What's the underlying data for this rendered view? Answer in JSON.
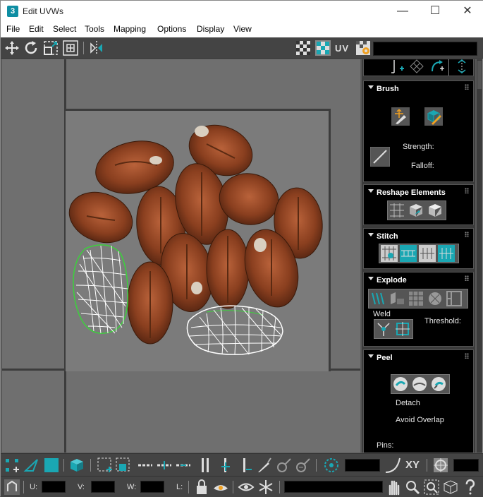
{
  "window": {
    "app_icon": "3",
    "title": "Edit UVWs"
  },
  "menu": [
    "File",
    "Edit",
    "Select",
    "Tools",
    "Mapping",
    "Options",
    "Display",
    "View"
  ],
  "toolbar_top": {
    "uv_label": "UV",
    "icons": [
      "move-icon",
      "rotate-icon",
      "scale-icon",
      "freeform-icon",
      "mirror-icon",
      "checker-icon",
      "texture-checker-icon",
      "settings-icon"
    ]
  },
  "panel": {
    "brush": {
      "title": "Brush",
      "strength_label": "Strength:",
      "falloff_label": "Falloff:"
    },
    "reshape": {
      "title": "Reshape Elements"
    },
    "stitch": {
      "title": "Stitch"
    },
    "explode": {
      "title": "Explode",
      "weld_label": "Weld",
      "threshold_label": "Threshold:"
    },
    "peel": {
      "title": "Peel",
      "detach_label": "Detach",
      "avoid_overlap_label": "Avoid Overlap",
      "pins_label": "Pins:"
    }
  },
  "bottom": {
    "xy_label": "XY",
    "u_label": "U:",
    "v_label": "V:",
    "w_label": "W:",
    "l_label": "L:"
  },
  "colors": {
    "accent": "#1aa7b3",
    "selection_green": "#3bd23b",
    "panel_bg": "#000000"
  }
}
